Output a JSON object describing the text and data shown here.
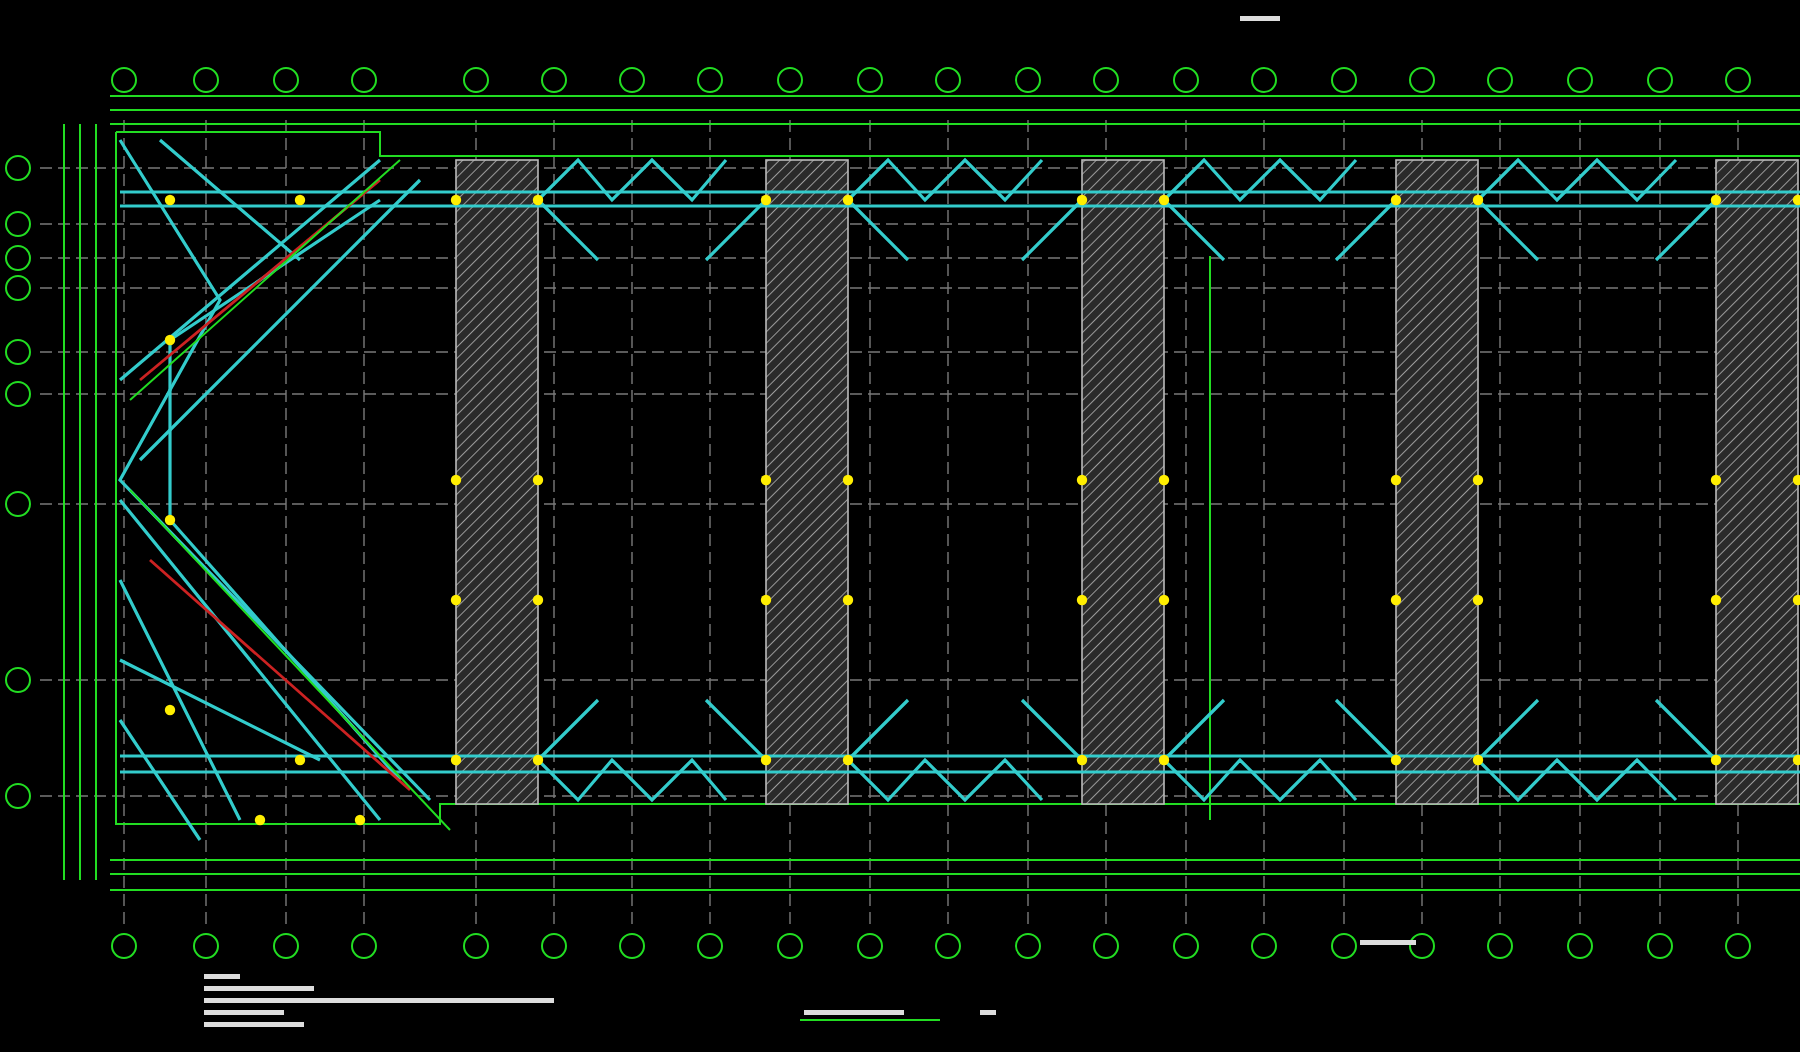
{
  "drawing": {
    "kind": "structural-plan",
    "strips": [
      {
        "kind": "hatched"
      },
      {
        "kind": "hatched"
      },
      {
        "kind": "hatched"
      },
      {
        "kind": "hatched"
      },
      {
        "kind": "hatched"
      }
    ]
  }
}
